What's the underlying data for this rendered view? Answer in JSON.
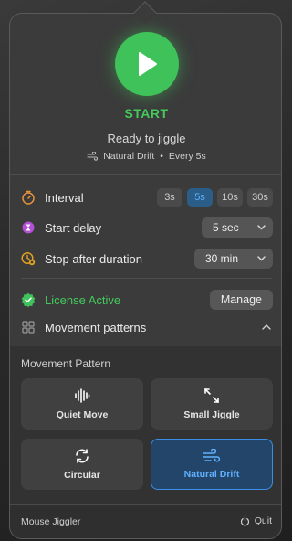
{
  "hero": {
    "start_label": "START",
    "status": "Ready to jiggle",
    "mode": "Natural Drift",
    "separator": "•",
    "every": "Every 5s"
  },
  "interval": {
    "label": "Interval",
    "options": [
      "3s",
      "5s",
      "10s",
      "30s"
    ],
    "selected": "5s"
  },
  "start_delay": {
    "label": "Start delay",
    "value": "5 sec"
  },
  "stop_after": {
    "label": "Stop after duration",
    "value": "30 min"
  },
  "license": {
    "label": "License Active",
    "manage_label": "Manage"
  },
  "patterns_toggle": {
    "label": "Movement patterns"
  },
  "movement": {
    "title": "Movement Pattern",
    "cards": [
      {
        "label": "Quiet Move",
        "icon": "waveform-icon",
        "selected": false
      },
      {
        "label": "Small Jiggle",
        "icon": "expand-arrows-icon",
        "selected": false
      },
      {
        "label": "Circular",
        "icon": "circular-arrows-icon",
        "selected": false
      },
      {
        "label": "Natural Drift",
        "icon": "wind-icon",
        "selected": true
      }
    ]
  },
  "footer": {
    "app_name": "Mouse Jiggler",
    "quit_label": "Quit"
  },
  "colors": {
    "accent_green": "#43c95c",
    "accent_blue": "#3a8ee6",
    "selected_text_blue": "#5fb1ff"
  }
}
